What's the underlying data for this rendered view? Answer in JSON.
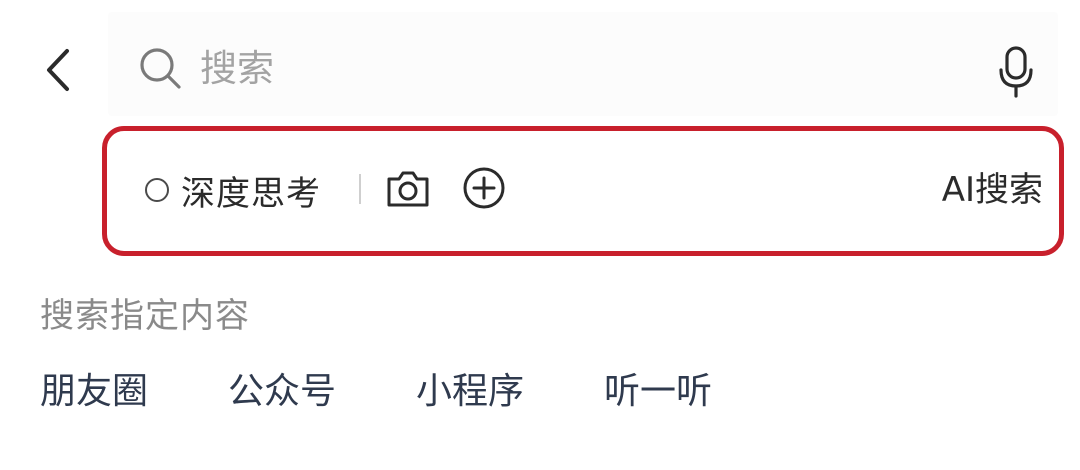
{
  "search": {
    "placeholder": "搜索",
    "value": ""
  },
  "toolbar": {
    "deep_think_label": "深度思考",
    "deep_think_checked": false,
    "ai_search_label": "AI搜索",
    "highlight_color": "#c8202c"
  },
  "section": {
    "title": "搜索指定内容"
  },
  "categories": [
    {
      "label": "朋友圈"
    },
    {
      "label": "公众号"
    },
    {
      "label": "小程序"
    },
    {
      "label": "听一听"
    }
  ],
  "icons": {
    "back": "chevron-left-icon",
    "search": "magnifier-icon",
    "mic": "microphone-icon",
    "camera": "camera-icon",
    "plus": "circle-plus-icon"
  }
}
